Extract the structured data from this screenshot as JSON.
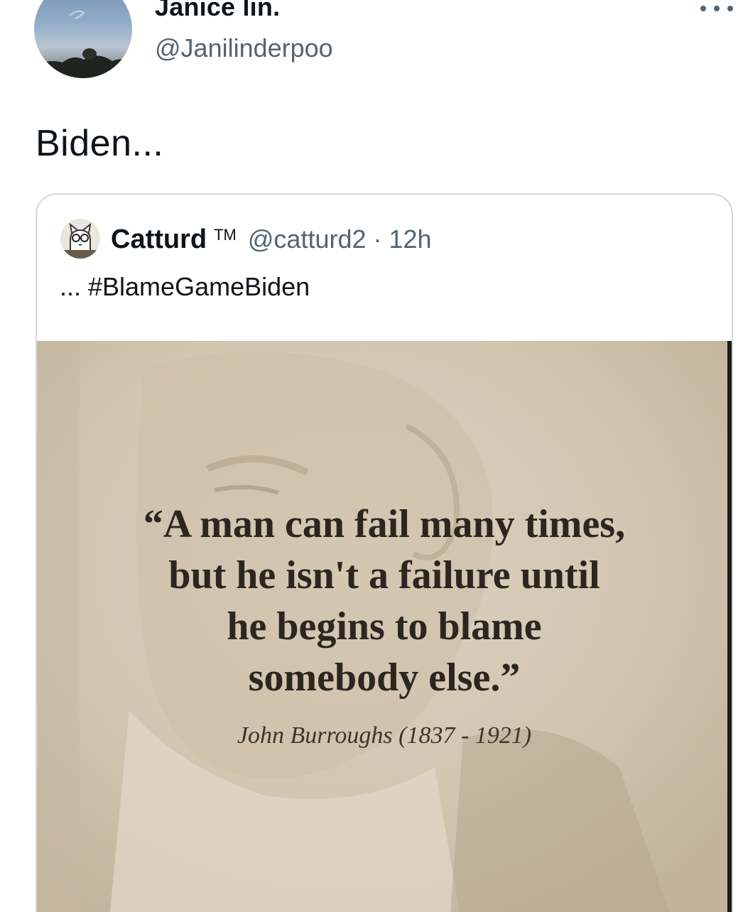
{
  "tweet": {
    "author_name": "Janice lin.",
    "author_handle": "@Janilinderpoo",
    "text": "Biden..."
  },
  "quoted_tweet": {
    "author_name": "Catturd",
    "author_badge": "TM",
    "author_handle": "@catturd2",
    "separator": "·",
    "time": "12h",
    "text": "... #BlameGameBiden",
    "image": {
      "quote_lines": [
        "“A man can fail many times,",
        "but he isn't a failure until",
        "he begins to blame",
        "somebody else.”"
      ],
      "attribution": "John Burroughs (1837 - 1921)"
    }
  },
  "icons": {
    "more": "more-horizontal-icon"
  },
  "colors": {
    "text_primary": "#0f1419",
    "text_secondary": "#536471",
    "card_border": "#cfd9de",
    "sepia_background": "#d4c9b6"
  }
}
